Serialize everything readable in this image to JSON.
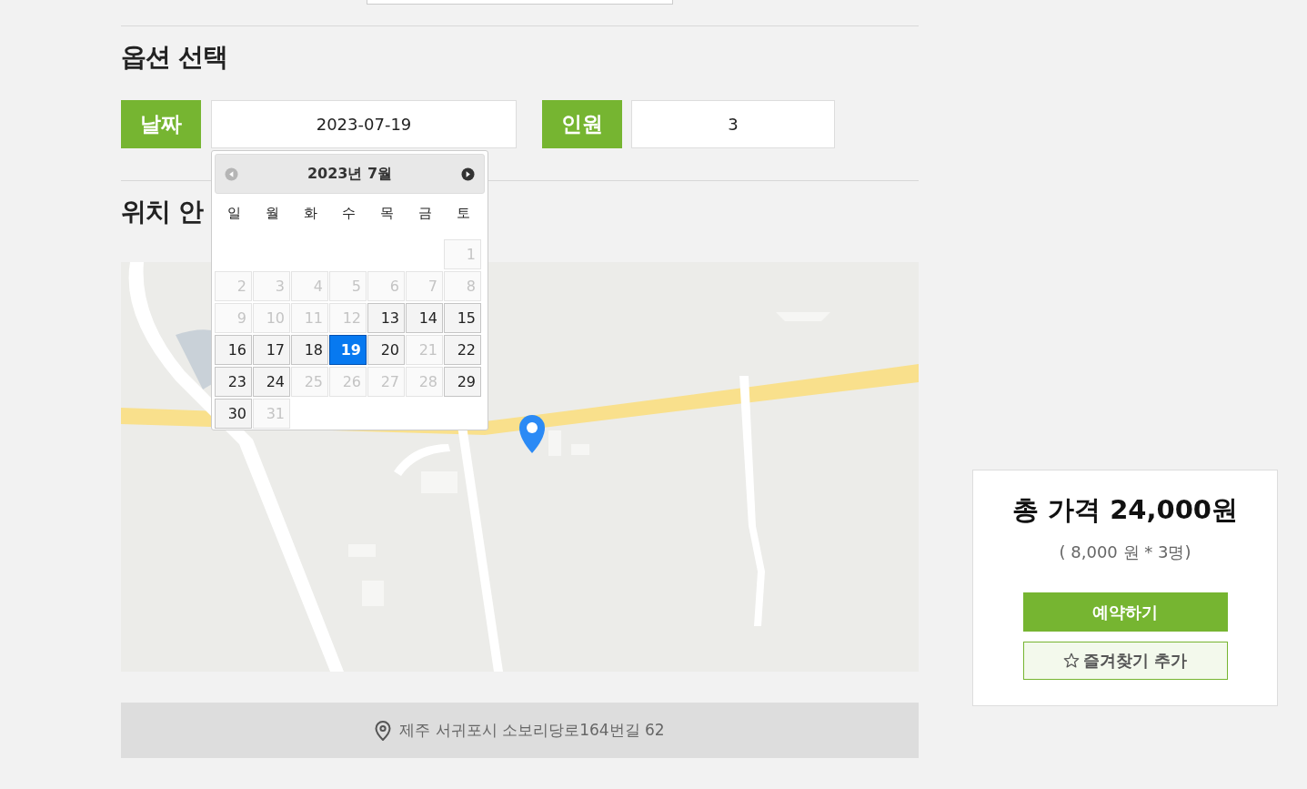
{
  "options": {
    "title": "옵션 선택",
    "date": {
      "label": "날짜",
      "value": "2023-07-19"
    },
    "people": {
      "label": "인원",
      "value": "3"
    }
  },
  "calendar": {
    "title": "2023년 7월",
    "prev": {
      "disabled": true
    },
    "next": {
      "disabled": false
    },
    "weekdays": [
      "일",
      "월",
      "화",
      "수",
      "목",
      "금",
      "토"
    ],
    "weeks": [
      [
        {
          "kind": "blank"
        },
        {
          "kind": "blank"
        },
        {
          "kind": "blank"
        },
        {
          "kind": "blank"
        },
        {
          "kind": "blank"
        },
        {
          "kind": "blank"
        },
        {
          "kind": "day",
          "day": "1",
          "disabled": true,
          "selected": false
        }
      ],
      [
        {
          "day": "2",
          "disabled": true,
          "selected": false
        },
        {
          "day": "3",
          "disabled": true,
          "selected": false
        },
        {
          "day": "4",
          "disabled": true,
          "selected": false
        },
        {
          "day": "5",
          "disabled": true,
          "selected": false
        },
        {
          "day": "6",
          "disabled": true,
          "selected": false
        },
        {
          "day": "7",
          "disabled": true,
          "selected": false
        },
        {
          "day": "8",
          "disabled": true,
          "selected": false
        }
      ],
      [
        {
          "day": "9",
          "disabled": true,
          "selected": false
        },
        {
          "day": "10",
          "disabled": true,
          "selected": false
        },
        {
          "day": "11",
          "disabled": true,
          "selected": false
        },
        {
          "day": "12",
          "disabled": true,
          "selected": false
        },
        {
          "day": "13",
          "disabled": false,
          "selected": false
        },
        {
          "day": "14",
          "disabled": false,
          "selected": false
        },
        {
          "day": "15",
          "disabled": false,
          "selected": false
        }
      ],
      [
        {
          "day": "16",
          "disabled": false,
          "selected": false
        },
        {
          "day": "17",
          "disabled": false,
          "selected": false
        },
        {
          "day": "18",
          "disabled": false,
          "selected": false
        },
        {
          "day": "19",
          "disabled": false,
          "selected": true
        },
        {
          "day": "20",
          "disabled": false,
          "selected": false
        },
        {
          "day": "21",
          "disabled": true,
          "selected": false
        },
        {
          "day": "22",
          "disabled": false,
          "selected": false
        }
      ],
      [
        {
          "day": "23",
          "disabled": false,
          "selected": false
        },
        {
          "day": "24",
          "disabled": false,
          "selected": false
        },
        {
          "day": "25",
          "disabled": true,
          "selected": false
        },
        {
          "day": "26",
          "disabled": true,
          "selected": false
        },
        {
          "day": "27",
          "disabled": true,
          "selected": false
        },
        {
          "day": "28",
          "disabled": true,
          "selected": false
        },
        {
          "day": "29",
          "disabled": false,
          "selected": false
        }
      ],
      [
        {
          "day": "30",
          "disabled": false,
          "selected": false
        },
        {
          "day": "31",
          "disabled": true,
          "selected": false
        }
      ]
    ]
  },
  "location": {
    "title": "위치 안",
    "address": "제주 서귀포시 소보리당로164번길 62"
  },
  "price": {
    "total": "총 가격 24,000원",
    "breakdown": "( 8,000 원 * 3명)",
    "book_button": "예약하기",
    "favorite_button": "즐겨찾기 추가"
  }
}
